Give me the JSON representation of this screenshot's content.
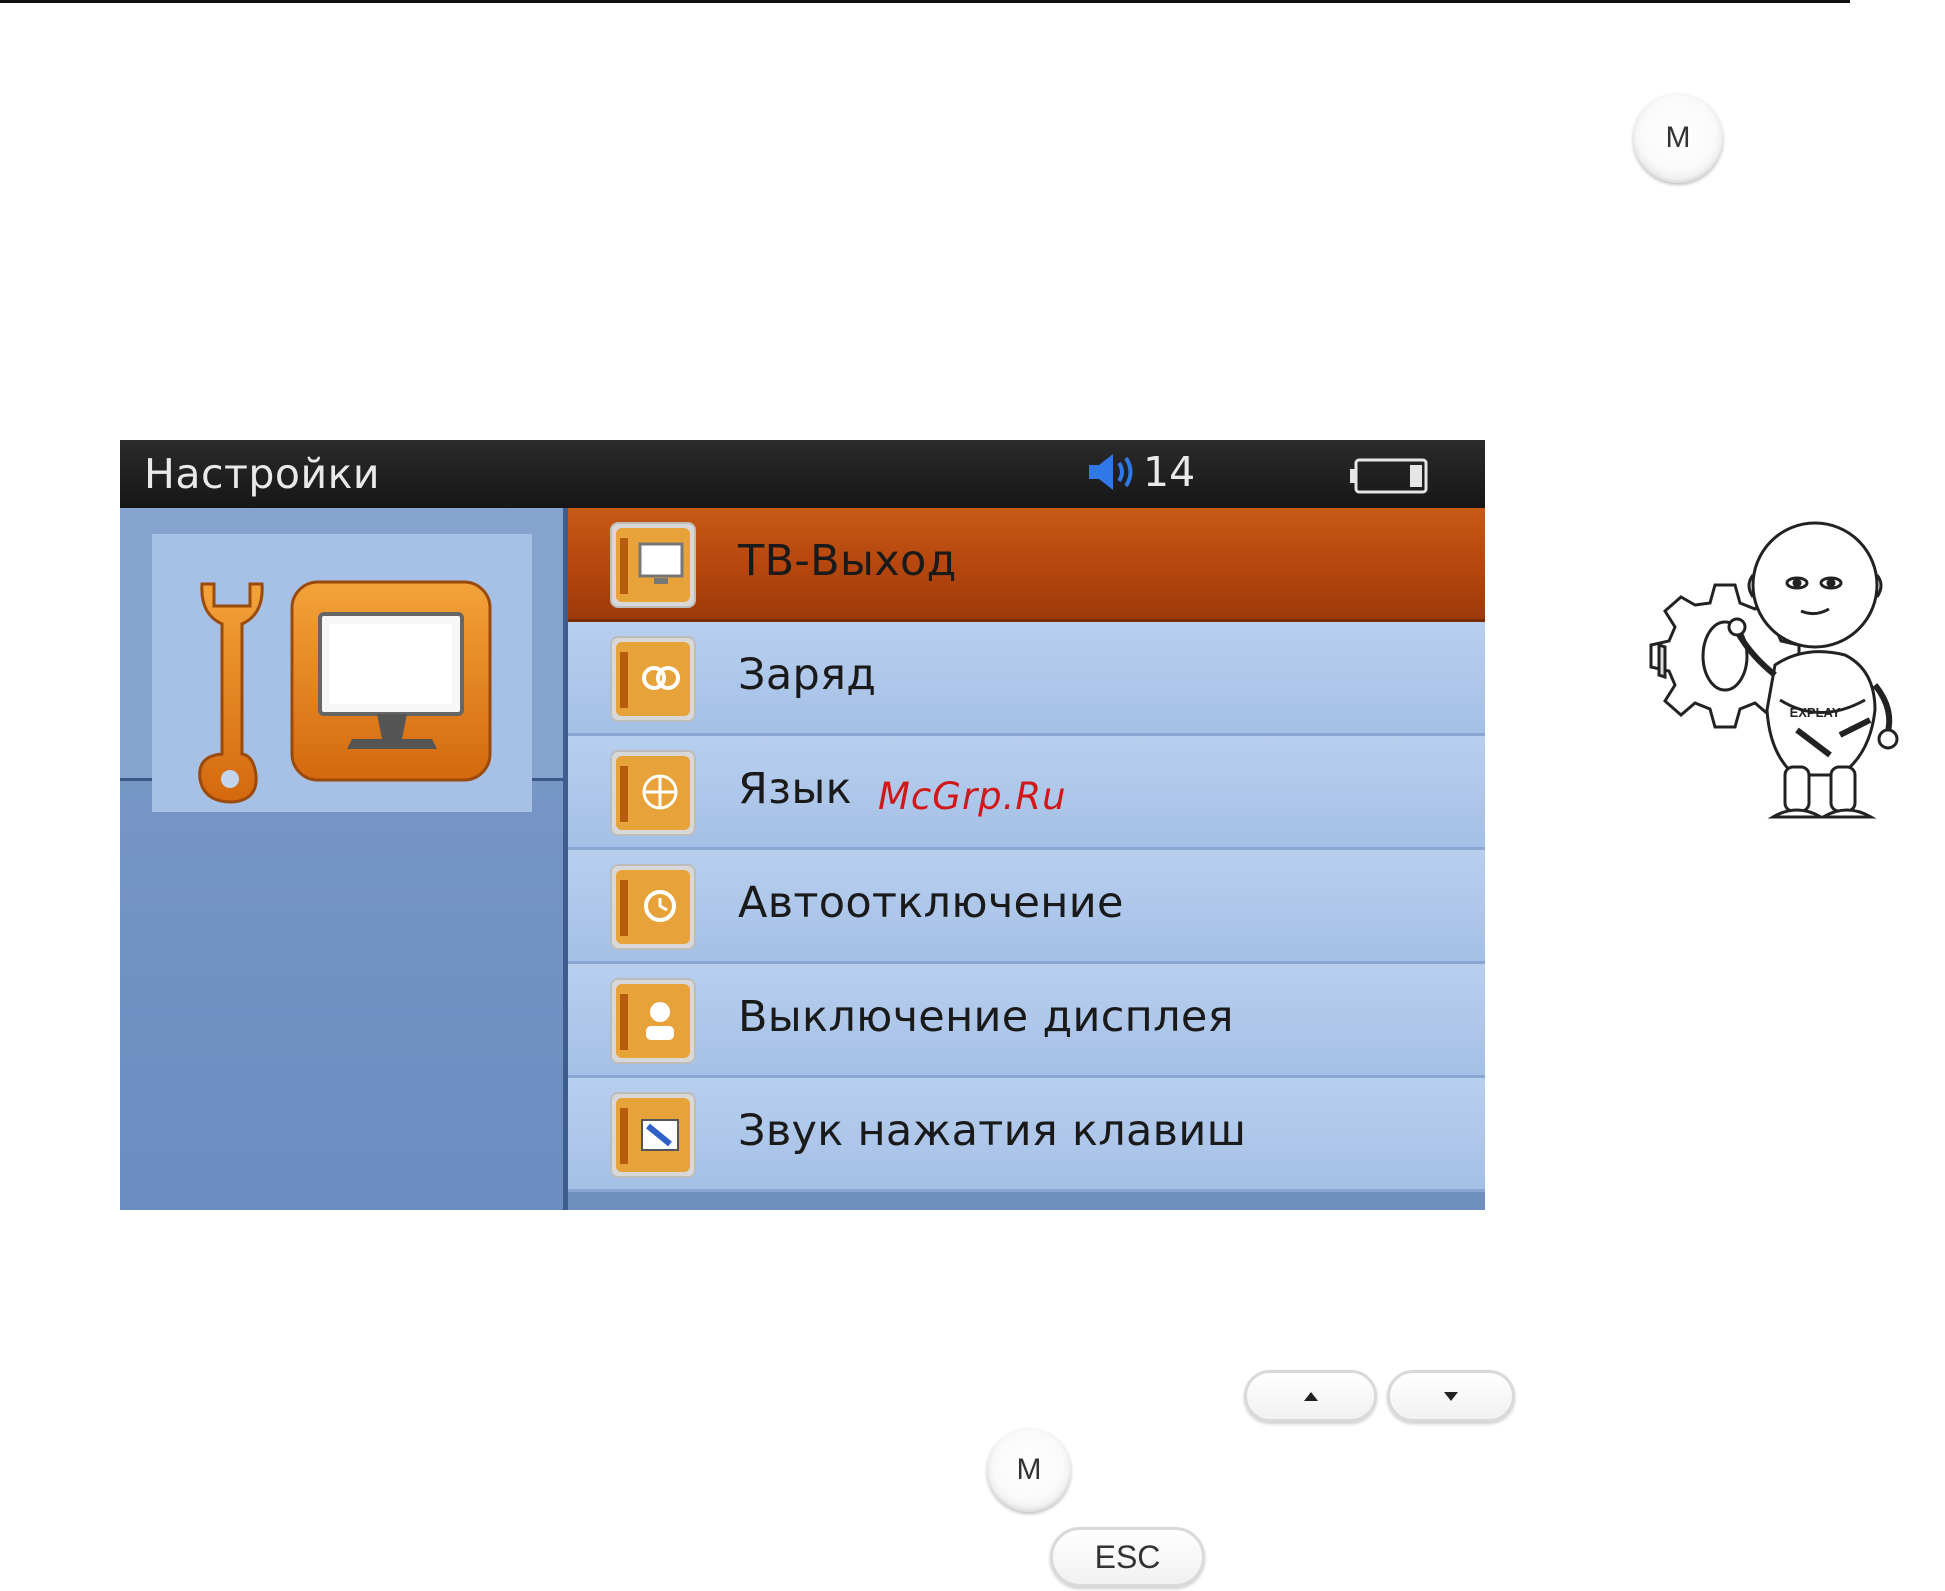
{
  "page": {
    "buttons": {
      "m_top": "M",
      "m_bottom": "M",
      "esc": "ESC"
    }
  },
  "screen": {
    "title": "Настройки",
    "volume": "14",
    "icons": {
      "volume": "speaker-icon",
      "battery": "battery-icon",
      "header": "wrench-monitor-icon"
    },
    "menu": [
      {
        "label": "ТВ-Выход",
        "icon": "tv-out-icon",
        "selected": true
      },
      {
        "label": "Заряд",
        "icon": "charge-icon",
        "selected": false
      },
      {
        "label": "Язык",
        "icon": "language-icon",
        "selected": false
      },
      {
        "label": "Автоотключение",
        "icon": "auto-off-icon",
        "selected": false
      },
      {
        "label": "Выключение дисплея",
        "icon": "display-off-icon",
        "selected": false
      },
      {
        "label": "Звук нажатия клавиш",
        "icon": "key-sound-icon",
        "selected": false
      }
    ],
    "colors": {
      "selected": "#b7470f",
      "item": "#b8cfee",
      "titlebar": "#1c1c1c"
    }
  },
  "watermark": "McGrp.Ru",
  "mascot_logo": "EXPLAY"
}
